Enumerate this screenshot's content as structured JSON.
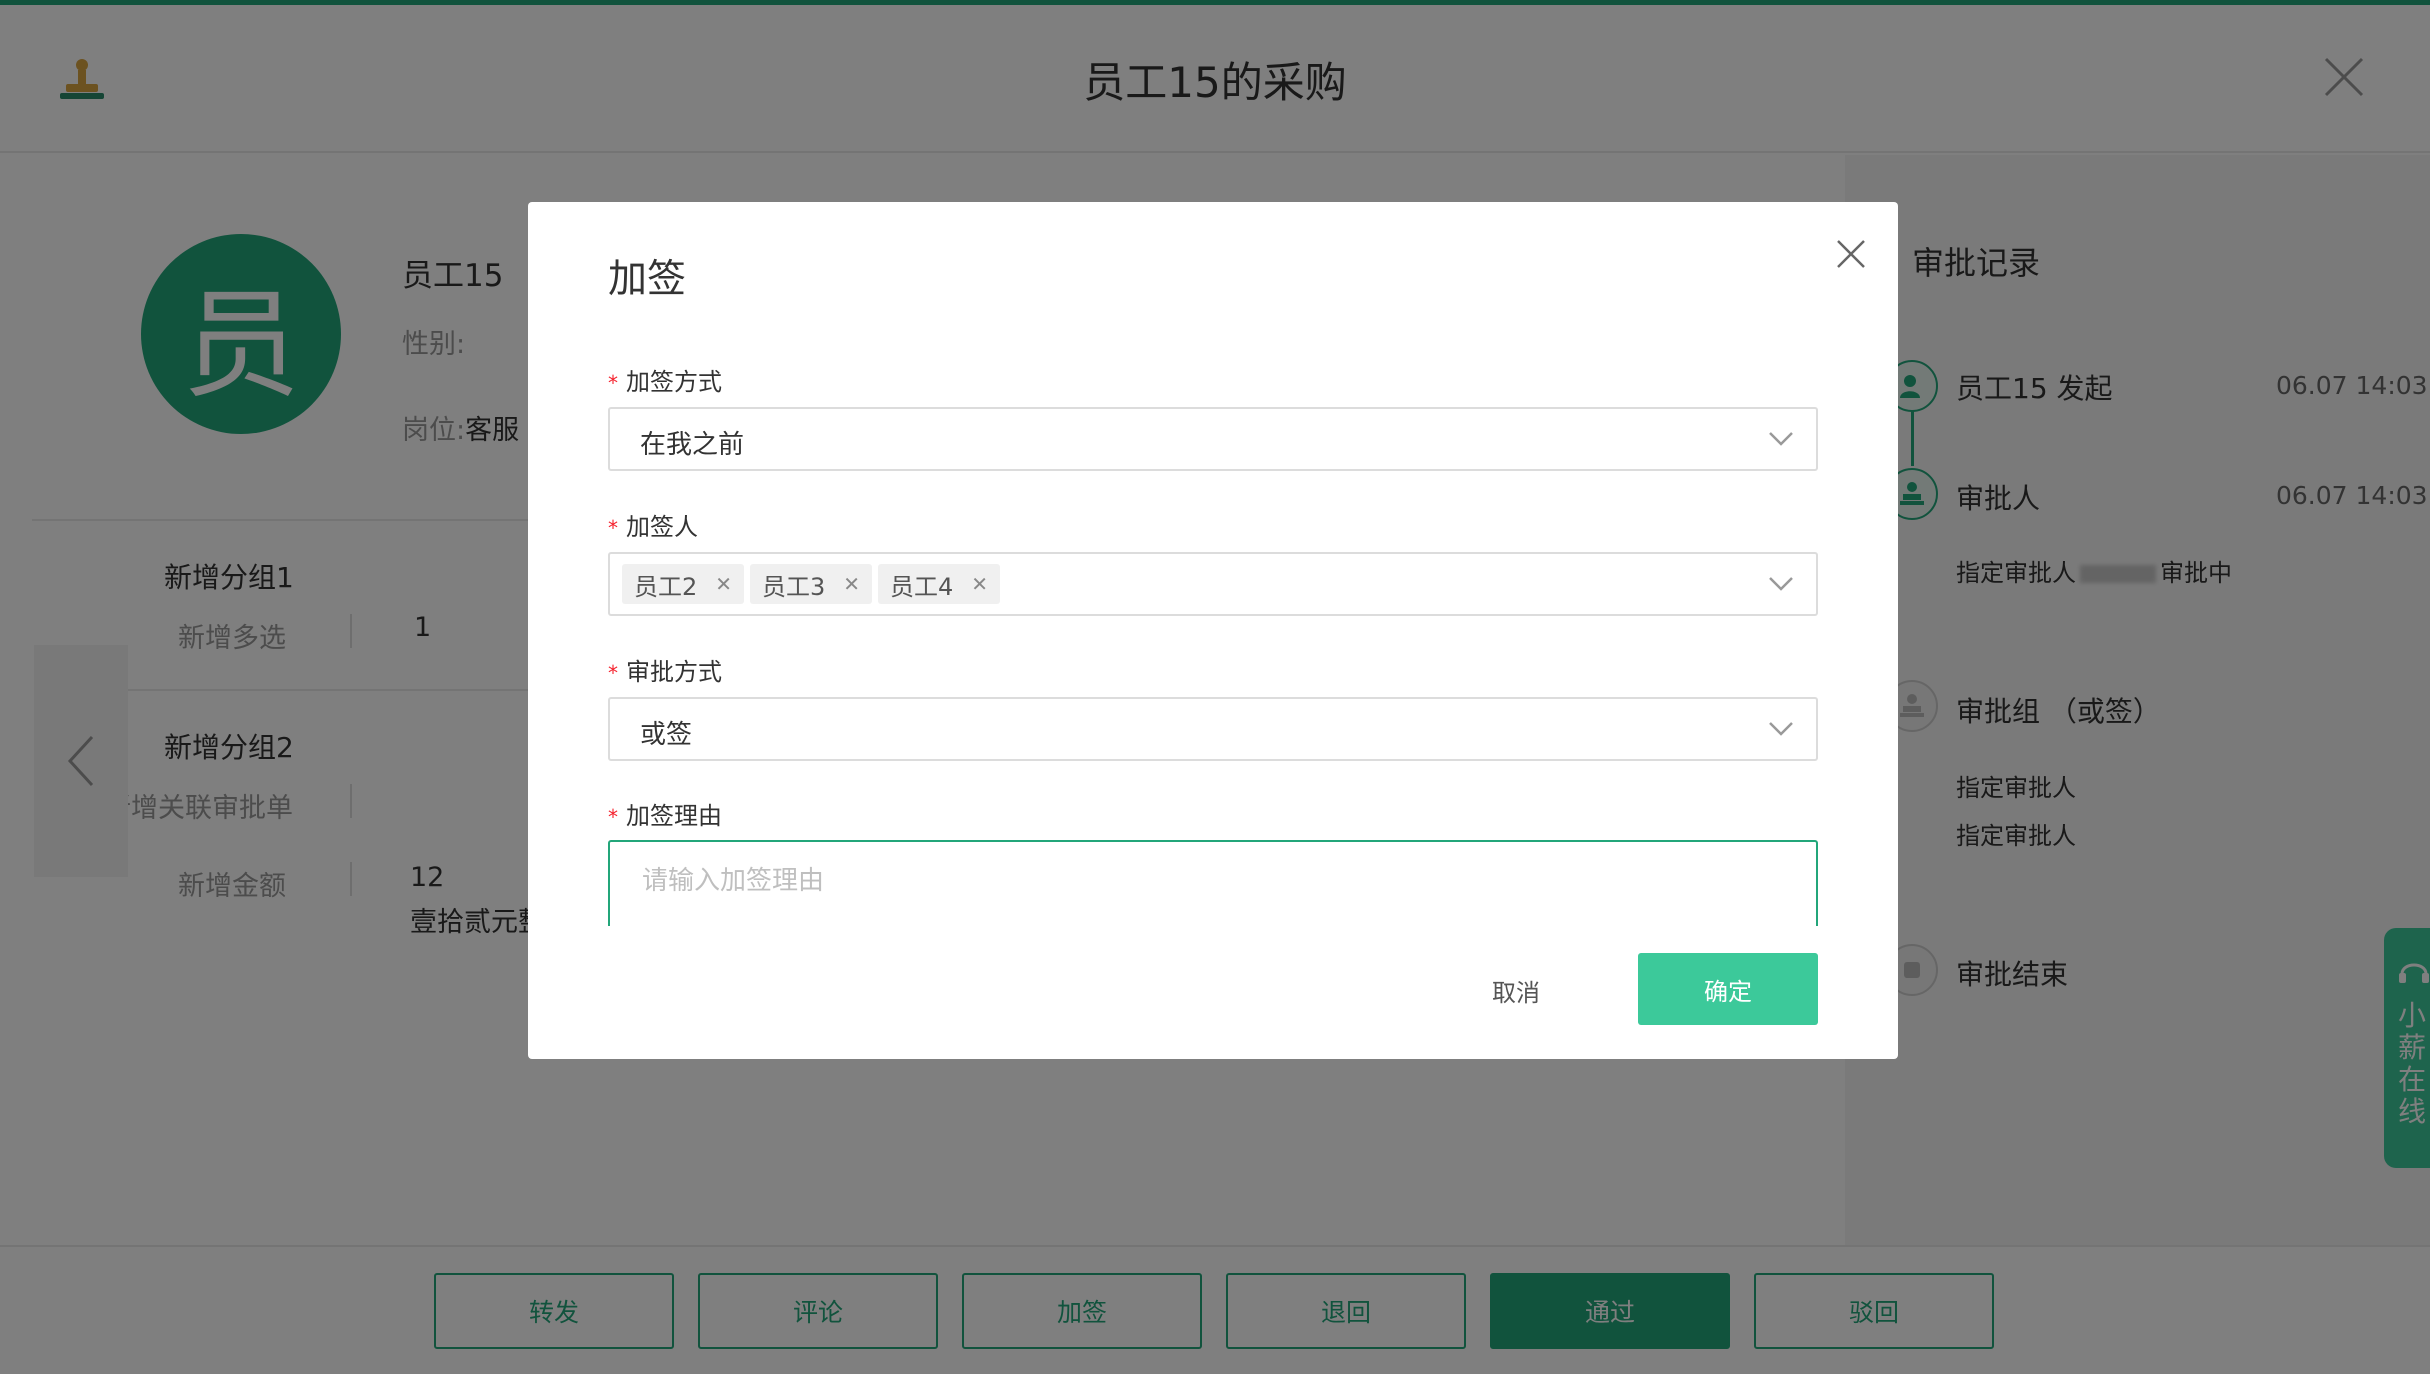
{
  "header": {
    "title": "员工15的采购",
    "stamp_icon": "stamp-icon",
    "close_icon": "close-icon"
  },
  "profile": {
    "avatar_char": "员",
    "name": "员工15",
    "gender_label": "性别:",
    "post_label": "岗位:",
    "post_value": "客服"
  },
  "groups": [
    {
      "title": "新增分组1",
      "fields": [
        {
          "label": "新增多选",
          "value": "1"
        }
      ]
    },
    {
      "title": "新增分组2",
      "fields": [
        {
          "label": "新增关联审批单",
          "value": ""
        },
        {
          "label": "新增金额",
          "value": "12",
          "value2": "壹拾贰元整"
        }
      ]
    }
  ],
  "record": {
    "title": "审批记录",
    "items": [
      {
        "name": "员工15 发起",
        "time": "06.07 14:03"
      },
      {
        "name": "审批人",
        "time": "06.07 14:03",
        "sub_prefix": "指定审批人",
        "sub_suffix": "审批中"
      },
      {
        "name": "审批组 （或签）",
        "subs": [
          "指定审批人",
          "指定审批人"
        ]
      },
      {
        "name": "审批结束"
      }
    ]
  },
  "chat": {
    "label": "小薪在线"
  },
  "footer": {
    "buttons": [
      "转发",
      "评论",
      "加签",
      "退回",
      "通过",
      "驳回"
    ]
  },
  "modal": {
    "title": "加签",
    "method_label": "加签方式",
    "method_value": "在我之前",
    "signer_label": "加签人",
    "signers": [
      "员工2",
      "员工3",
      "员工4"
    ],
    "approve_label": "审批方式",
    "approve_value": "或签",
    "reason_label": "加签理由",
    "reason_placeholder": "请输入加签理由",
    "cancel": "取消",
    "ok": "确定"
  },
  "colors": {
    "brand": "#23a67a",
    "primary_button": "#3cc99a",
    "required": "#f5222d"
  }
}
